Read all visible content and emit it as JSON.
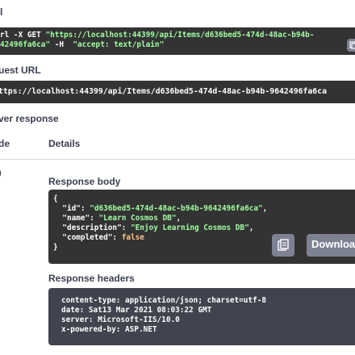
{
  "curl": {
    "heading": "l",
    "line1_prefix": "rl -X GET ",
    "line1_url": "\"https://localhost:44399/api/Items/d636bed5-474d-48ac-b94b-",
    "line2_id": "42496fa6ca\"",
    "line2_mid": " -H  ",
    "line2_accept": "\"accept: text/plain\""
  },
  "request_url": {
    "heading": "uest URL",
    "value": "ttps://localhost:44399/api/Items/d636bed5-474d-48ac-b94b-9642496fa6ca"
  },
  "server_response": {
    "heading": "ver response",
    "col_code": "de",
    "col_details": "Details",
    "code_partial": "0"
  },
  "response_body": {
    "heading": "Response body",
    "open_brace": "{",
    "close_brace": "}",
    "fields": [
      {
        "key": "\"id\"",
        "value": "\"d636bed5-474d-48ac-b94b-9642496fa6ca\"",
        "sep": ",",
        "type": "string"
      },
      {
        "key": "\"name\"",
        "value": "\"Learn Cosmos DB\"",
        "sep": ",",
        "type": "string"
      },
      {
        "key": "\"description\"",
        "value": "\"Enjoy Learning Cosmos DB\"",
        "sep": ",",
        "type": "string"
      },
      {
        "key": "\"completed\"",
        "value": "false",
        "sep": "",
        "type": "literal"
      }
    ],
    "download_label": "Download"
  },
  "response_headers": {
    "heading": "Response headers",
    "lines": [
      "content-type: application/json; charset=utf-8",
      "date: Sat13 Mar 2021 08:03:22 GMT",
      "server: Microsoft-IIS/10.0",
      "x-powered-by: ASP.NET"
    ]
  },
  "icons": {
    "copy": "clipboard-copy-icon",
    "copy_curl": "clipboard-copy-icon"
  }
}
